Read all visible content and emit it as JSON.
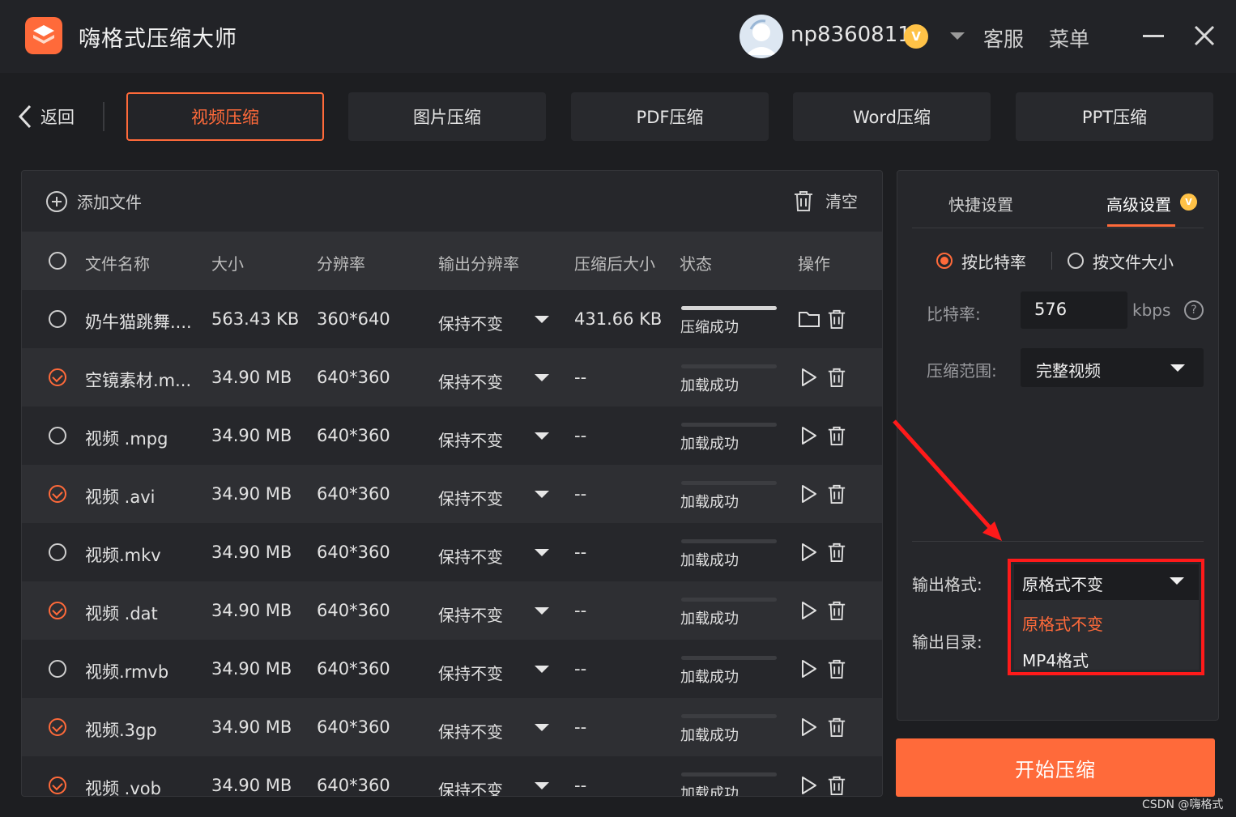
{
  "app": {
    "title": "嗨格式压缩大师",
    "username": "np8360811",
    "vip_badge": "V",
    "support": "客服",
    "menu": "菜单"
  },
  "nav": {
    "back_label": "返回",
    "tabs": [
      {
        "label": "视频压缩",
        "active": true
      },
      {
        "label": "图片压缩",
        "active": false
      },
      {
        "label": "PDF压缩",
        "active": false
      },
      {
        "label": "Word压缩",
        "active": false
      },
      {
        "label": "PPT压缩",
        "active": false
      }
    ]
  },
  "file_panel": {
    "add_file": "添加文件",
    "clear": "清空",
    "columns": [
      "文件名称",
      "大小",
      "分辨率",
      "输出分辨率",
      "压缩后大小",
      "状态",
      "操作"
    ],
    "rows": [
      {
        "name": "奶牛猫跳舞....",
        "size": "563.43 KB",
        "resolution": "360*640",
        "output_resolution": "保持不变",
        "compressed_size": "431.66 KB",
        "status": "压缩成功",
        "progress": 1.0,
        "checked": false,
        "action": "open-folder"
      },
      {
        "name": "空镜素材.m...",
        "size": "34.90 MB",
        "resolution": "640*360",
        "output_resolution": "保持不变",
        "compressed_size": "--",
        "status": "加载成功",
        "progress": 0,
        "checked": true,
        "action": "play"
      },
      {
        "name": "视频 .mpg",
        "size": "34.90 MB",
        "resolution": "640*360",
        "output_resolution": "保持不变",
        "compressed_size": "--",
        "status": "加载成功",
        "progress": 0,
        "checked": false,
        "action": "play"
      },
      {
        "name": "视频 .avi",
        "size": "34.90 MB",
        "resolution": "640*360",
        "output_resolution": "保持不变",
        "compressed_size": "--",
        "status": "加载成功",
        "progress": 0,
        "checked": true,
        "action": "play"
      },
      {
        "name": "视频.mkv",
        "size": "34.90 MB",
        "resolution": "640*360",
        "output_resolution": "保持不变",
        "compressed_size": "--",
        "status": "加载成功",
        "progress": 0,
        "checked": false,
        "action": "play"
      },
      {
        "name": "视频 .dat",
        "size": "34.90 MB",
        "resolution": "640*360",
        "output_resolution": "保持不变",
        "compressed_size": "--",
        "status": "加载成功",
        "progress": 0,
        "checked": true,
        "action": "play"
      },
      {
        "name": "视频.rmvb",
        "size": "34.90 MB",
        "resolution": "640*360",
        "output_resolution": "保持不变",
        "compressed_size": "--",
        "status": "加载成功",
        "progress": 0,
        "checked": false,
        "action": "play"
      },
      {
        "name": "视频.3gp",
        "size": "34.90 MB",
        "resolution": "640*360",
        "output_resolution": "保持不变",
        "compressed_size": "--",
        "status": "加载成功",
        "progress": 0,
        "checked": true,
        "action": "play"
      },
      {
        "name": "视频 .vob",
        "size": "34.90 MB",
        "resolution": "640*360",
        "output_resolution": "保持不变",
        "compressed_size": "--",
        "status": "加载成功",
        "progress": 0,
        "checked": true,
        "action": "play"
      }
    ]
  },
  "settings": {
    "tab_quick": "快捷设置",
    "tab_advanced": "高级设置",
    "mode_bitrate": "按比特率",
    "mode_filesize": "按文件大小",
    "bitrate_label": "比特率:",
    "bitrate_value": "576",
    "bitrate_unit": "kbps",
    "help": "?",
    "range_label": "压缩范围:",
    "range_value": "完整视频",
    "output_format_label": "输出格式:",
    "output_format_value": "原格式不变",
    "output_dir_label": "输出目录:",
    "format_options": [
      "原格式不变",
      "MP4格式"
    ]
  },
  "start_button": "开始压缩",
  "watermark": "CSDN @嗨格式",
  "colors": {
    "accent": "#ff6a3a",
    "highlight": "#ff1a1a",
    "background": "#1d1e21"
  }
}
